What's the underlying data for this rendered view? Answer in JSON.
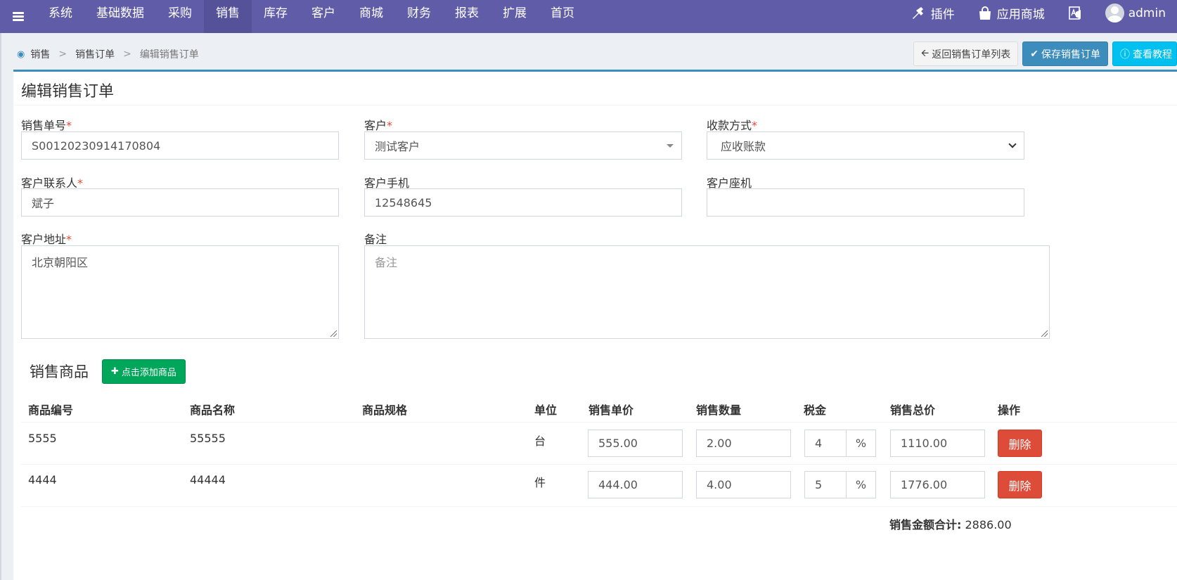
{
  "nav": {
    "items": [
      "系统",
      "基础数据",
      "采购",
      "销售",
      "库存",
      "客户",
      "商城",
      "财务",
      "报表",
      "扩展",
      "首页"
    ],
    "active_index": 3,
    "plugin_label": "插件",
    "store_label": "应用商城",
    "user_label": "admin"
  },
  "breadcrumb": {
    "root": "销售",
    "parent": "销售订单",
    "current": "编辑销售订单",
    "sep": ">"
  },
  "actions": {
    "back_label": "返回销售订单列表",
    "save_label": "保存销售订单",
    "tutorial_label": "查看教程"
  },
  "form": {
    "title": "编辑销售订单",
    "order_no_label": "销售单号",
    "order_no": "S00120230914170804",
    "customer_label": "客户",
    "customer": "测试客户",
    "payment_label": "收款方式",
    "payment": "应收账款",
    "contact_label": "客户联系人",
    "contact": "斌子",
    "mobile_label": "客户手机",
    "mobile": "12548645",
    "phone_label": "客户座机",
    "phone": "",
    "address_label": "客户地址",
    "address": "北京朝阳区",
    "remark_label": "备注",
    "remark_placeholder": "备注",
    "required_mark": "*"
  },
  "products": {
    "section_title": "销售商品",
    "add_button": "点击添加商品",
    "headers": [
      "商品编号",
      "商品名称",
      "商品规格",
      "单位",
      "销售单价",
      "销售数量",
      "税金",
      "销售总价",
      "操作"
    ],
    "rows": [
      {
        "code": "5555",
        "name": "55555",
        "spec": "",
        "unit": "台",
        "price": "555.00",
        "qty": "2.00",
        "tax": "4",
        "tax_unit": "%",
        "total": "1110.00",
        "action": "删除"
      },
      {
        "code": "4444",
        "name": "44444",
        "spec": "",
        "unit": "件",
        "price": "444.00",
        "qty": "4.00",
        "tax": "5",
        "tax_unit": "%",
        "total": "1776.00",
        "action": "删除"
      }
    ],
    "sum_label": "销售金额合计:",
    "sum_value": "2886.00"
  },
  "colors": {
    "nav_bg": "#605ca8",
    "primary": "#3c8dbc",
    "success": "#00a65a",
    "danger": "#dd4b39",
    "info": "#00c0ef"
  }
}
